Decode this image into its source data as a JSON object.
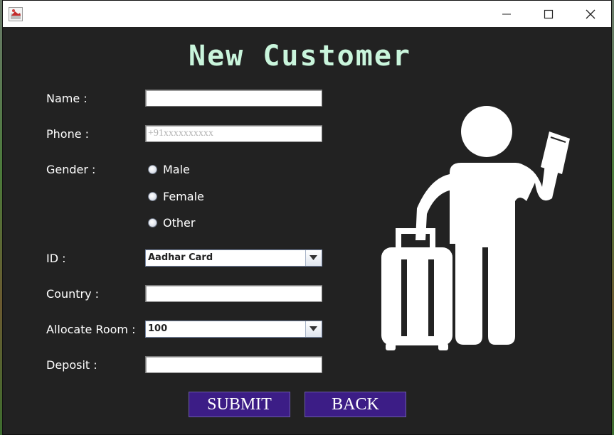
{
  "window": {
    "title_icon": "java-app-icon",
    "controls": [
      "minimize-icon",
      "maximize-icon",
      "close-icon"
    ]
  },
  "form": {
    "title": "New Customer",
    "title_color": "#c9f5dc",
    "labels": {
      "name": "Name :",
      "phone": "Phone :",
      "gender": "Gender :",
      "id": "ID :",
      "country": "Country :",
      "room": "Allocate Room :",
      "deposit": "Deposit :"
    },
    "fields": {
      "name_value": "",
      "phone_value": "",
      "phone_placeholder": "+91xxxxxxxxxx",
      "country_value": "",
      "deposit_value": ""
    },
    "gender_options": [
      "Male",
      "Female",
      "Other"
    ],
    "id_selected": "Aadhar Card",
    "room_selected": "100",
    "buttons": {
      "submit": "SUBMIT",
      "back": "BACK"
    },
    "button_color": "#3c1d86"
  },
  "illustration": "traveler-with-luggage-icon"
}
